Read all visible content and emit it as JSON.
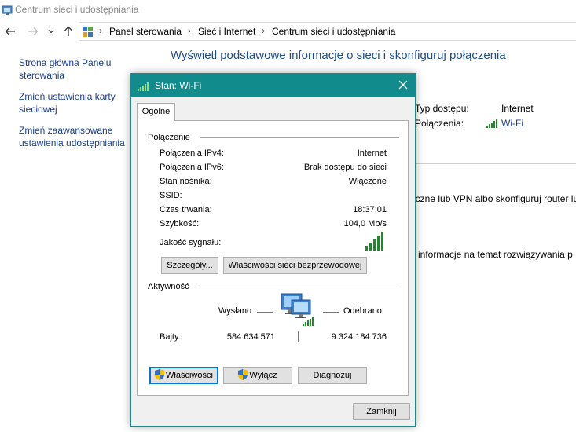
{
  "window": {
    "title": "Centrum sieci i udostępniania"
  },
  "nav": {
    "back_icon": "arrow-left-icon",
    "forward_icon": "arrow-right-icon",
    "recent_icon": "chevron-down-icon",
    "up_icon": "arrow-up-icon"
  },
  "breadcrumb": {
    "items": [
      "Panel sterowania",
      "Sieć i Internet",
      "Centrum sieci i udostępniania"
    ],
    "separator": ">"
  },
  "leftnav": {
    "links": [
      "Strona główna Panelu sterowania",
      "Zmień ustawienia karty sieciowej",
      "Zmień zaawansowane ustawienia udostępniania"
    ]
  },
  "main": {
    "title": "Wyświetl podstawowe informacje o sieci i skonfiguruj połączenia",
    "access_type_label": "Typ dostępu:",
    "access_type_value": "Internet",
    "connections_label": "Połączenia:",
    "connections_value": "Wi-Fi",
    "text_vpn": "iczne lub VPN albo skonfiguruj router lu",
    "text_troubleshoot": "j informacje na temat rozwiązywania p"
  },
  "dialog": {
    "title": "Stan: Wi-Fi",
    "close_icon": "close-icon",
    "tab": "Ogólne",
    "connection_group": "Połączenie",
    "rows": [
      {
        "label": "Połączenia IPv4:",
        "value": "Internet"
      },
      {
        "label": "Połączenia IPv6:",
        "value": "Brak dostępu do sieci"
      },
      {
        "label": "Stan nośnika:",
        "value": "Włączone"
      },
      {
        "label": "SSID:",
        "value": ""
      },
      {
        "label": "Czas trwania:",
        "value": "18:37:01"
      },
      {
        "label": "Szybkość:",
        "value": "104,0 Mb/s"
      }
    ],
    "signal_label": "Jakość sygnału:",
    "signal_level": 5,
    "signal_max": 5,
    "details_button": "Szczegóły...",
    "wireless_props_button": "Właściwości sieci bezprzewodowej",
    "activity_group": "Aktywność",
    "sent_label": "Wysłano",
    "received_label": "Odebrano",
    "bytes_label": "Bajty:",
    "bytes_sent": "584 634 571",
    "bytes_received": "9 324 184 736",
    "properties_button": "Właściwości",
    "disable_button": "Wyłącz",
    "diagnose_button": "Diagnozuj",
    "close_button": "Zamknij"
  },
  "colors": {
    "title_bar": "#118b8c",
    "link": "#1a3e8c",
    "heading": "#1e4d8c",
    "signal": "#1e8a2a"
  }
}
